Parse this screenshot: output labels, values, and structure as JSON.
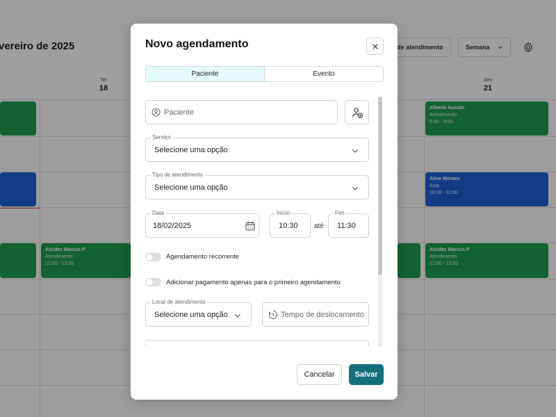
{
  "background": {
    "title": "vereiro de 2025",
    "buttons": [
      "de atendimento",
      "Semana"
    ],
    "days": [
      {
        "name": "Ter",
        "num": "18"
      },
      {
        "name": "Sex",
        "num": "21"
      }
    ],
    "events": [
      {
        "name": "Alberto Ausuto",
        "type": "Atendimento",
        "time": "8:00 - 9:00"
      },
      {
        "name": "Aline Moraes",
        "type": "Aula",
        "time": "10:00 - 11:00"
      },
      {
        "name": "Alcidez Marcus P",
        "type": "Atendimento",
        "time": "12:00 - 13:00"
      },
      {
        "name": "Alcidez Marcus P",
        "type": "Atendimento",
        "time": "12:00 - 13:00"
      }
    ]
  },
  "modal": {
    "title": "Novo agendamento",
    "tabs": [
      "Paciente",
      "Evento"
    ],
    "patient": {
      "placeholder": "Paciente"
    },
    "service": {
      "label": "Serviço",
      "value": "Selecione uma opção"
    },
    "attendance_type": {
      "label": "Tipo de atendimento",
      "value": "Selecione uma opção"
    },
    "date": {
      "label": "Data",
      "value": "18/02/2025"
    },
    "start": {
      "label": "Início",
      "value": "10:30"
    },
    "until": "até",
    "end": {
      "label": "Fim",
      "value": "11:30"
    },
    "recurring_label": "Agendamento recorrente",
    "payment_label": "Adicionar pagamento apenas para o primeiro agendamento",
    "location": {
      "label": "Local de atendimento",
      "value": "Selecione uma opção"
    },
    "travel_time": {
      "placeholder": "Tempo de deslocamento"
    },
    "cancel_label": "Cancelar",
    "save_label": "Salvar"
  },
  "colors": {
    "accent": "#13707a",
    "event_green": "#1e9e52",
    "event_blue": "#1f5fd8"
  }
}
